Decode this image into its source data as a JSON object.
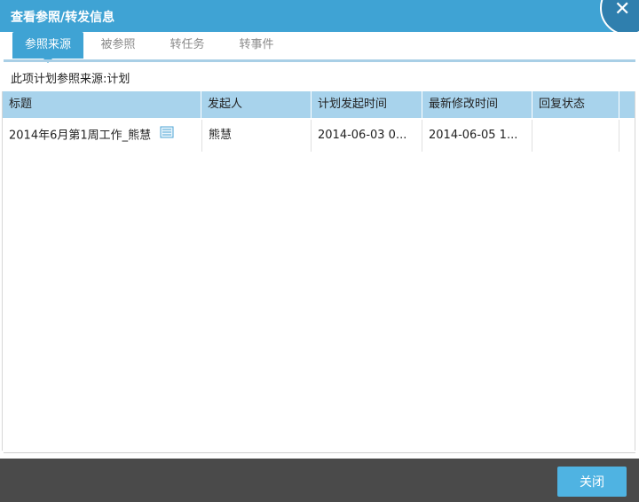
{
  "window": {
    "title": "查看参照/转发信息",
    "close_icon": "close-icon"
  },
  "tabs": [
    {
      "label": "参照来源",
      "active": true
    },
    {
      "label": "被参照",
      "active": false
    },
    {
      "label": "转任务",
      "active": false
    },
    {
      "label": "转事件",
      "active": false
    }
  ],
  "description": "此项计划参照来源:计划",
  "table": {
    "columns": [
      "标题",
      "发起人",
      "计划发起时间",
      "最新修改时间",
      "回复状态"
    ],
    "rows": [
      {
        "title": "2014年6月第1周工作_熊慧",
        "initiator": "熊慧",
        "plan_time": "2014-06-03 0...",
        "modified_time": "2014-06-05 1...",
        "reply_status": ""
      }
    ]
  },
  "footer": {
    "close_label": "关闭"
  },
  "colors": {
    "titlebar": "#3fa3d4",
    "header": "#a8d3ec",
    "footer": "#4a4a4a",
    "button": "#4fb3e2"
  }
}
